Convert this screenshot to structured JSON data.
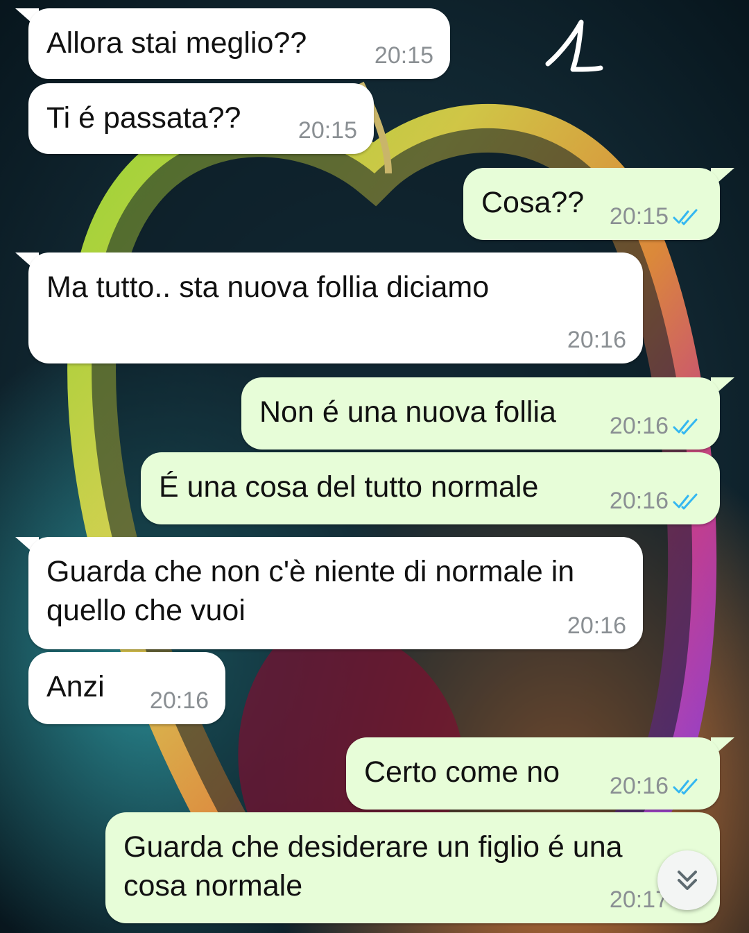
{
  "annotation_mark": "1",
  "messages": [
    {
      "text": "Allora stai meglio??",
      "time": "20:15",
      "dir": "in"
    },
    {
      "text": "Ti é passata??",
      "time": "20:15",
      "dir": "in"
    },
    {
      "text": "Cosa??",
      "time": "20:15",
      "dir": "out"
    },
    {
      "text": "Ma tutto.. sta nuova follia diciamo",
      "time": "20:16",
      "dir": "in"
    },
    {
      "text": "Non é una nuova follia",
      "time": "20:16",
      "dir": "out"
    },
    {
      "text": "É una cosa del tutto normale",
      "time": "20:16",
      "dir": "out"
    },
    {
      "text": "Guarda che non c'è niente di normale in quello che vuoi",
      "time": "20:16",
      "dir": "in"
    },
    {
      "text": "Anzi",
      "time": "20:16",
      "dir": "in"
    },
    {
      "text": "Certo come no",
      "time": "20:16",
      "dir": "out"
    },
    {
      "text": "Guarda che desiderare un figlio é una cosa normale",
      "time": "20:17",
      "dir": "out"
    }
  ],
  "icons": {
    "read_receipt": "double-check-icon",
    "scroll": "chevron-double-down-icon"
  },
  "colors": {
    "incoming_bg": "#ffffff",
    "outgoing_bg": "#e7fdd8",
    "tick": "#34b7f1",
    "time": "#8a8f93"
  }
}
